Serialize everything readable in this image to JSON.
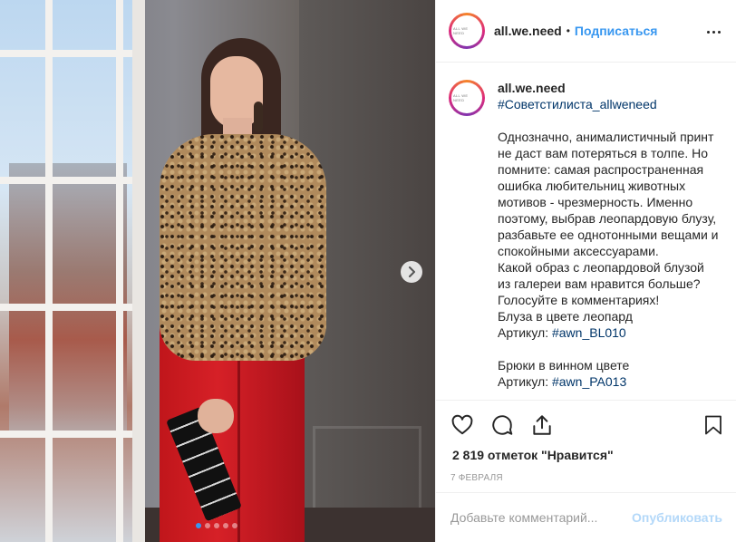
{
  "post": {
    "carousel_total": 5,
    "carousel_active": 1
  },
  "header": {
    "username": "all.we.need",
    "separator": "•",
    "follow_label": "Подписаться",
    "avatar_text": "ALL WE NEED"
  },
  "caption": {
    "username": "all.we.need",
    "hashtag_top": "#Советстилиста_allweneed",
    "lines": [
      "Однозначно, анималистичный принт",
      "не даст вам потеряться в толпе. Но",
      "помните: самая распространенная",
      "ошибка любительниц животных",
      "мотивов - чрезмерность. Именно",
      "поэтому, выбрав леопардовую блузу,",
      "разбавьте ее однотонными вещами и",
      "спокойными аксессуарами.",
      "Какой образ с леопардовой блузой",
      "из галереи вам нравится больше?",
      "Голосуйте в комментариях!",
      "Блуза в цвете леопард"
    ],
    "article1_label": "Артикул: ",
    "article1_tag": "#awn_BL010",
    "trousers_line": "Брюки в винном цвете",
    "article2_label": "Артикул: ",
    "article2_tag": "#awn_PA013"
  },
  "actions": {
    "like_icon": "heart-icon",
    "comment_icon": "comment-icon",
    "share_icon": "share-icon",
    "save_icon": "bookmark-icon"
  },
  "likes_text": "2 819 отметок \"Нравится\"",
  "date_text": "7 ФЕВРАЛЯ",
  "comment": {
    "placeholder": "Добавьте комментарий...",
    "publish_label": "Опубликовать"
  },
  "colors": {
    "link_blue": "#3897f0",
    "hashtag": "#003569",
    "publish_disabled": "#b3d8f9"
  }
}
